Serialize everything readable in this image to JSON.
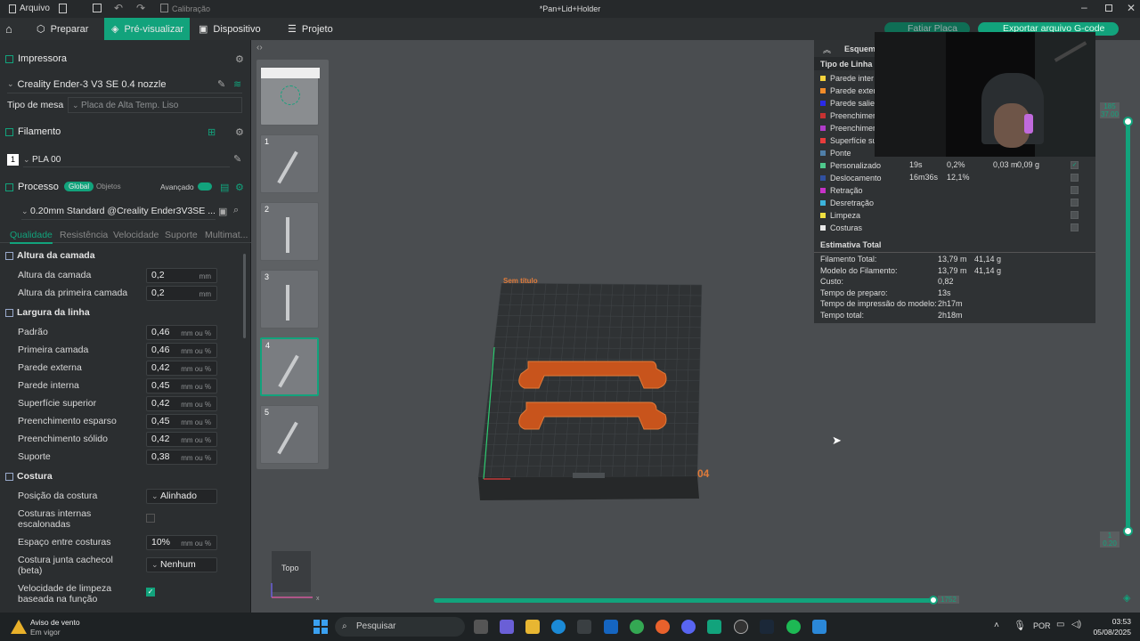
{
  "titlebar": {
    "menu": "Arquivo",
    "calibration": "Calibração",
    "title": "*Pan+Lid+Holder"
  },
  "nav": {
    "prepare": "Preparar",
    "preview": "Pré-visualizar",
    "device": "Dispositivo",
    "project": "Projeto",
    "slice": "Fatiar Placa",
    "export": "Exportar arquivo G-code"
  },
  "printer": {
    "section": "Impressora",
    "name": "Creality Ender-3 V3 SE 0.4 nozzle",
    "bed_label": "Tipo de mesa",
    "bed_value": "Placa de Alta Temp. Liso"
  },
  "filament": {
    "section": "Filamento",
    "slot": "1",
    "name": "PLA 00"
  },
  "process": {
    "section": "Processo",
    "global": "Global",
    "objects": "Objetos",
    "advanced": "Avançado",
    "preset": "0.20mm Standard @Creality Ender3V3SE ...",
    "tabs": [
      "Qualidade",
      "Resistência",
      "Velocidade",
      "Suporte",
      "Multimat..."
    ]
  },
  "settings": {
    "layer_height_group": "Altura da camada",
    "layer_height": {
      "label": "Altura da camada",
      "value": "0,2",
      "unit": "mm"
    },
    "first_layer_height": {
      "label": "Altura da primeira camada",
      "value": "0,2",
      "unit": "mm"
    },
    "line_width_group": "Largura da linha",
    "line_widths": [
      {
        "label": "Padrão",
        "value": "0,46",
        "unit": "mm ou %"
      },
      {
        "label": "Primeira camada",
        "value": "0,46",
        "unit": "mm ou %"
      },
      {
        "label": "Parede externa",
        "value": "0,42",
        "unit": "mm ou %"
      },
      {
        "label": "Parede interna",
        "value": "0,45",
        "unit": "mm ou %"
      },
      {
        "label": "Superfície superior",
        "value": "0,42",
        "unit": "mm ou %"
      },
      {
        "label": "Preenchimento esparso",
        "value": "0,45",
        "unit": "mm ou %"
      },
      {
        "label": "Preenchimento sólido",
        "value": "0,42",
        "unit": "mm ou %"
      },
      {
        "label": "Suporte",
        "value": "0,38",
        "unit": "mm ou %"
      }
    ],
    "seam_group": "Costura",
    "seam_position": {
      "label": "Posição da costura",
      "value": "Alinhado"
    },
    "staggered_line1": "Costuras internas",
    "staggered_line2": "escalonadas",
    "seam_gap": {
      "label": "Espaço entre costuras",
      "value": "10%",
      "unit": "mm ou %"
    },
    "scarf_line1": "Costura junta cachecol",
    "scarf_line2": "(beta)",
    "scarf_value": "Nenhum",
    "wipe_line1": "Velocidade de limpeza",
    "wipe_line2": "baseada na função"
  },
  "viewport": {
    "plate_name": "Sem título",
    "plate_number": "04",
    "view_cube": "Topo",
    "layer_top_a": "185",
    "layer_top_b": "37.00",
    "layer_bottom_a": "1",
    "layer_bottom_b": "0.20",
    "move_count": "1752"
  },
  "thumbs": [
    "1",
    "2",
    "3",
    "4",
    "5"
  ],
  "legend": {
    "title": "Esquem",
    "line_type": "Tipo de Linha",
    "rows": [
      {
        "name": "Parede inter",
        "color": "#f5d33d"
      },
      {
        "name": "Parede exter",
        "color": "#f28c2a"
      },
      {
        "name": "Parede salie",
        "color": "#2a2ae8"
      },
      {
        "name": "Preenchimer",
        "color": "#c83232"
      },
      {
        "name": "Preenchimer",
        "color": "#b03cc8"
      },
      {
        "name": "Superfície su",
        "color": "#e83c3c"
      },
      {
        "name": "Ponte",
        "color": "#4f7fa8"
      },
      {
        "name": "Personalizado",
        "color": "#4ec88c",
        "time": "19s",
        "pct": "0,2%",
        "len": "0,03 m",
        "weight": "0,09 g"
      },
      {
        "name": "Deslocamento",
        "color": "#3050a0",
        "time": "16m36s",
        "pct": "12,1%"
      },
      {
        "name": "Retração",
        "color": "#c832c8"
      },
      {
        "name": "Desretração",
        "color": "#3cb4dc"
      },
      {
        "name": "Limpeza",
        "color": "#f0e040"
      },
      {
        "name": "Costuras",
        "color": "#e8e8e8"
      }
    ],
    "estimate_title": "Estimativa Total",
    "estimates": [
      {
        "label": "Filamento Total:",
        "v1": "13,79 m",
        "v2": "41,14 g"
      },
      {
        "label": "Modelo do Filamento:",
        "v1": "13,79 m",
        "v2": "41,14 g"
      },
      {
        "label": "Custo:",
        "v1": "0,82",
        "v2": ""
      },
      {
        "label": "Tempo de preparo:",
        "v1": "13s",
        "v2": ""
      },
      {
        "label": "Tempo de impressão do modelo:",
        "v1": "2h17m",
        "v2": ""
      },
      {
        "label": "Tempo total:",
        "v1": "2h18m",
        "v2": ""
      }
    ]
  },
  "taskbar": {
    "weather_title": "Aviso de vento",
    "weather_sub": "Em vigor",
    "search": "Pesquisar",
    "lang": "POR",
    "time": "03:53",
    "date": "05/08/2025"
  },
  "colors": {
    "accent": "#12a37c",
    "part": "#c8541c"
  }
}
